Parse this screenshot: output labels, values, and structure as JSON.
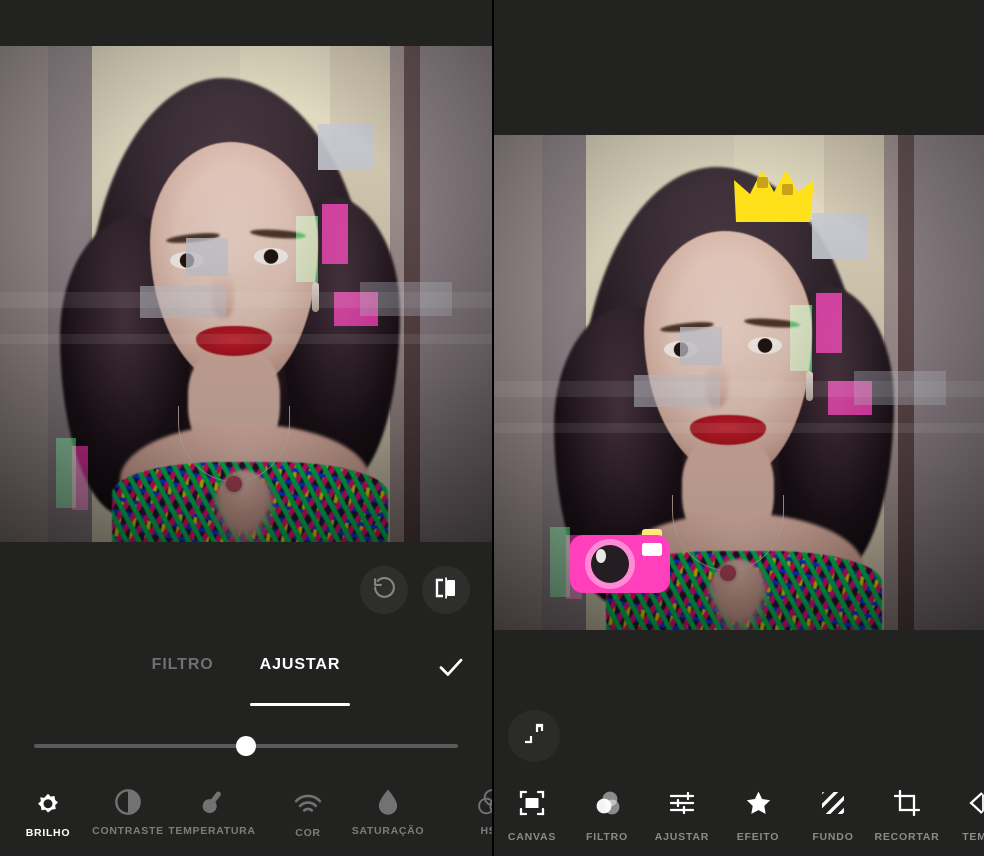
{
  "app": {
    "left_screen": {
      "top_bar_color": "#222221",
      "actions": [
        {
          "name": "reset",
          "icon": "undo-rotate-icon",
          "enabled": false
        },
        {
          "name": "compare",
          "icon": "before-after-compare-icon",
          "enabled": true
        }
      ],
      "tabs": [
        {
          "label": "FILTRO",
          "active": false
        },
        {
          "label": "AJUSTAR",
          "active": true
        }
      ],
      "confirm_label": "✓",
      "slider": {
        "value": 50,
        "min": 0,
        "max": 100
      },
      "tools": [
        {
          "label": "BRILHO",
          "icon": "brightness-icon",
          "active": true
        },
        {
          "label": "CONTRASTE",
          "icon": "contrast-icon",
          "active": false
        },
        {
          "label": "TEMPERATURA",
          "icon": "temperature-icon",
          "active": false
        },
        {
          "label": "COR",
          "icon": "tint-waves-icon",
          "active": false
        },
        {
          "label": "SATURAÇÃO",
          "icon": "droplet-icon",
          "active": false
        },
        {
          "label": "HSL",
          "icon": "hsl-circles-icon",
          "active": false
        }
      ]
    },
    "right_screen": {
      "collapse_icon": "collapse-corners-icon",
      "stickers": [
        {
          "name": "crown-sticker",
          "color": "#ffe11b"
        },
        {
          "name": "camera-sticker",
          "color": "#ff3fbb"
        }
      ],
      "nav": [
        {
          "label": "CANVAS",
          "icon": "canvas-frame-icon"
        },
        {
          "label": "FILTRO",
          "icon": "filter-circles-icon"
        },
        {
          "label": "AJUSTAR",
          "icon": "sliders-icon"
        },
        {
          "label": "EFEITO",
          "icon": "star-icon"
        },
        {
          "label": "FUNDO",
          "icon": "hatch-background-icon"
        },
        {
          "label": "RECORTAR",
          "icon": "crop-icon"
        },
        {
          "label": "TEMPL",
          "icon": "template-icon"
        }
      ]
    },
    "colors": {
      "panel_bg": "#222221",
      "accent_white": "#ffffff",
      "muted_text": "#7c7c7c",
      "crown_yellow": "#ffe11b",
      "camera_pink": "#ff3fbb"
    }
  }
}
